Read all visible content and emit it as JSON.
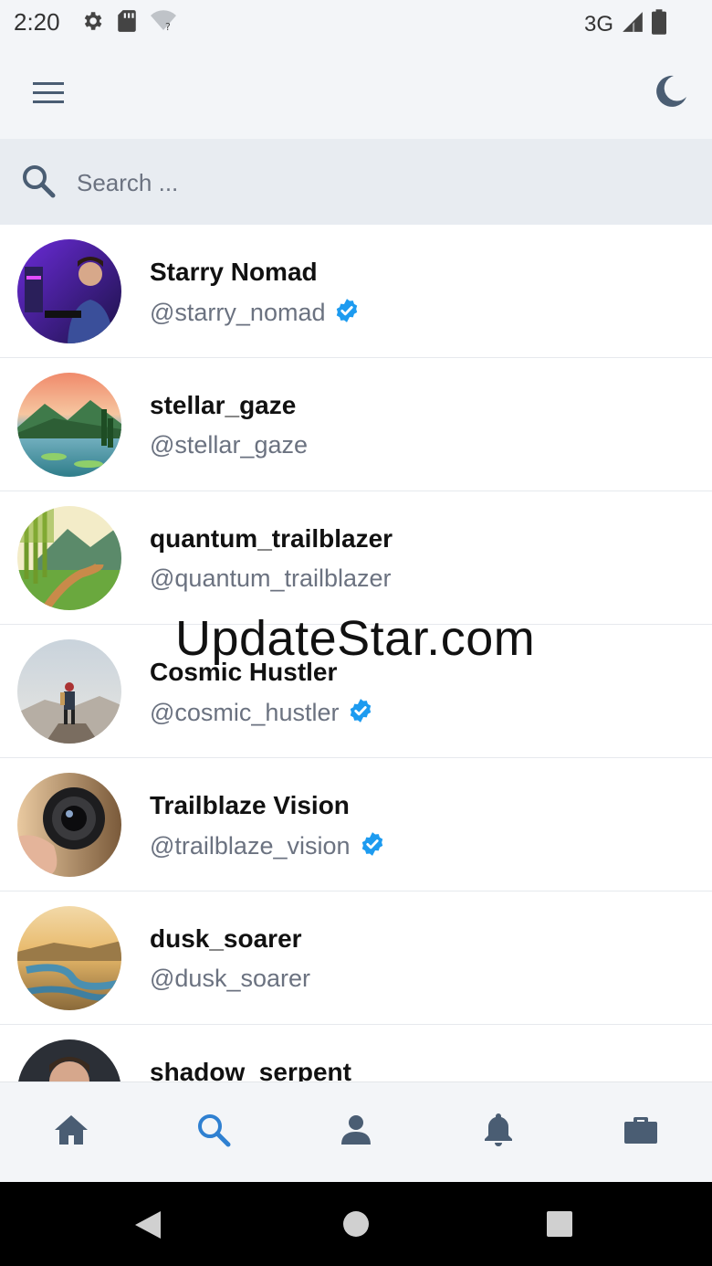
{
  "status_bar": {
    "time": "2:20",
    "network": "3G",
    "icons": [
      "settings-icon",
      "sd-card-icon",
      "wifi-unknown-icon",
      "signal-icon",
      "battery-icon"
    ]
  },
  "app_bar": {
    "icons": [
      "menu-icon",
      "dark-mode-moon-icon"
    ]
  },
  "search": {
    "placeholder": "Search ...",
    "value": ""
  },
  "users": [
    {
      "name": "Starry Nomad",
      "handle": "@starry_nomad",
      "verified": true
    },
    {
      "name": "stellar_gaze",
      "handle": "@stellar_gaze",
      "verified": false
    },
    {
      "name": "quantum_trailblazer",
      "handle": "@quantum_trailblazer",
      "verified": false
    },
    {
      "name": "Cosmic Hustler",
      "handle": "@cosmic_hustler",
      "verified": true
    },
    {
      "name": "Trailblaze Vision",
      "handle": "@trailblaze_vision",
      "verified": true
    },
    {
      "name": "dusk_soarer",
      "handle": "@dusk_soarer",
      "verified": false
    },
    {
      "name": "shadow_serpent",
      "handle": "",
      "verified": false
    }
  ],
  "watermark": "UpdateStar.com",
  "bottom_nav": {
    "items": [
      "home-icon",
      "search-icon",
      "profile-icon",
      "notifications-bell-icon",
      "briefcase-icon"
    ],
    "active": "search-icon"
  },
  "colors": {
    "accent": "#2f80d1",
    "verified": "#1d9bf0",
    "nav_icon": "#4a5d73",
    "bar_background": "#f3f5f8",
    "search_background": "#e8ecf1"
  }
}
